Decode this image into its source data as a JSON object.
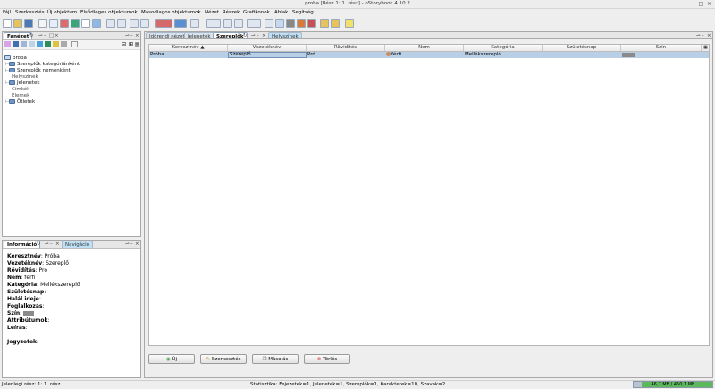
{
  "window": {
    "title": "proba [Rész 1: 1. rész] - oStorybook 4.10.2"
  },
  "menu": [
    "Fájl",
    "Szerkesztés",
    "Új objektum",
    "Elsődleges objektumok",
    "Másodlagos objektumok",
    "Nézet",
    "Részek",
    "Grafikonok",
    "Ablak",
    "Segítség"
  ],
  "tree_panel": {
    "tab": "Fanézet",
    "items": [
      "proba",
      "Szereplők kategóriánként",
      "Szereplők nemenként",
      "Helyszínek",
      "Jelenetek",
      "Címkék",
      "Elemek",
      "Ötletek"
    ]
  },
  "info_panel": {
    "tabs": [
      "Információ",
      "Navigáció"
    ],
    "fields": [
      {
        "label": "Keresztnév",
        "value": "Próba"
      },
      {
        "label": "Vezetéknév",
        "value": "Szereplő"
      },
      {
        "label": "Rövidítés",
        "value": "Pró"
      },
      {
        "label": "Nem",
        "value": "férfi"
      },
      {
        "label": "Kategória",
        "value": "Mellékszereplő"
      },
      {
        "label": "Születésnap",
        "value": ""
      },
      {
        "label": "Halál ideje",
        "value": ""
      },
      {
        "label": "Foglalkozás",
        "value": ""
      },
      {
        "label": "Szín",
        "value": ""
      },
      {
        "label": "Attribútumok",
        "value": ""
      },
      {
        "label": "Leírás",
        "value": ""
      },
      {
        "label": "Jegyzetek",
        "value": ""
      }
    ]
  },
  "main": {
    "tabs": [
      "Időrendi nézet",
      "Jelenetek",
      "Szereplők",
      "Helyszínek"
    ],
    "columns": [
      "Keresztnév ▲",
      "Vezetéknév",
      "Rövidítés",
      "Nem",
      "Kategória",
      "Születésnap",
      "Szín"
    ],
    "rows": [
      {
        "firstname": "Próba",
        "lastname": "Szereplő",
        "abbr": "Pró",
        "gender": "férfi",
        "category": "Mellékszereplő",
        "birthday": ""
      }
    ],
    "buttons": [
      "Új",
      "Szerkesztés",
      "Másolás",
      "Törlés"
    ]
  },
  "status": {
    "left": "Jelenlegi rész: 1: 1. rész",
    "stats": "Statisztika: Fejezetek=1,  Jelenetek=1,  Szereplők=1,  Karakterek=10,  Szavak=2",
    "memory": "46,7 MB / 450,1 MB",
    "memory_fraction": 0.104
  },
  "colors": {
    "selection": "#b8cfe5",
    "accent": "#d9e3ee",
    "memory_fill": "#5cb85c"
  }
}
